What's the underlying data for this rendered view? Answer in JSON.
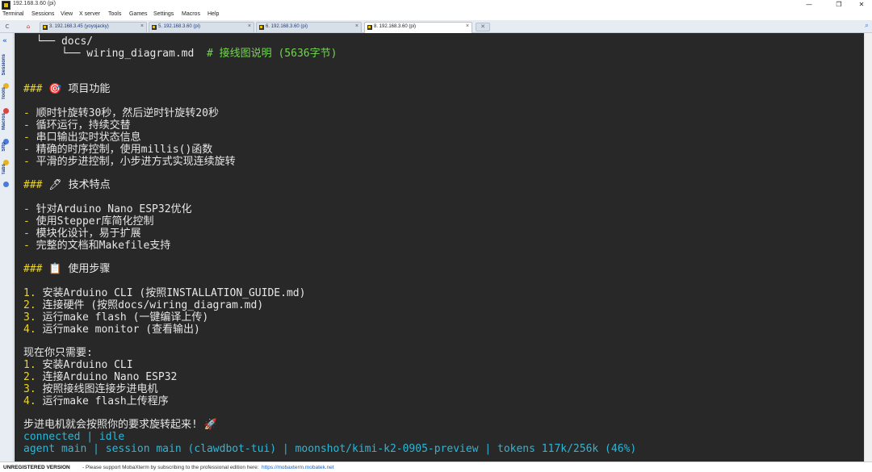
{
  "window": {
    "title": "192.168.3.60 (pi)",
    "minimize_glyph": "—",
    "restore_glyph": "❐",
    "close_glyph": "✕"
  },
  "menu": [
    "Terminal",
    "Sessions",
    "View",
    "X server",
    "Tools",
    "Games",
    "Settings",
    "Macros",
    "Help"
  ],
  "tabs": [
    {
      "label": "3. 192.168.3.45 (yoyojacky)",
      "active": false
    },
    {
      "label": "5. 192.168.3.60 (pi)",
      "active": false
    },
    {
      "label": "6. 192.168.3.60 (pi)",
      "active": false
    },
    {
      "label": "8. 192.168.3.60 (pi)",
      "active": true
    }
  ],
  "tab_close_glyph": "×",
  "sidebar": {
    "tabs": [
      "Sessions",
      "Tools",
      "Macros",
      "Sftp",
      "Tabs"
    ]
  },
  "terminal": {
    "tree_line_1": "  └── docs/",
    "tree_line_2_prefix": "      └── wiring_diagram.md  ",
    "tree_line_2_comment": "# 接线图说明 (5636字节)",
    "h_features_marker": "###",
    "h_features_text": " 🎯 项目功能",
    "features": [
      "顺时针旋转30秒，然后逆时针旋转20秒",
      "循环运行，持续交替",
      "串口输出实时状态信息",
      "精确的时序控制，使用millis()函数",
      "平滑的步进控制，小步进方式实现连续旋转"
    ],
    "h_tech_marker": "###",
    "h_tech_text": " 🖊 技术特点",
    "tech": [
      "针对Arduino Nano ESP32优化",
      "使用Stepper库简化控制",
      "模块化设计，易于扩展",
      "完整的文档和Makefile支持"
    ],
    "h_steps_marker": "###",
    "h_steps_text": " 📋 使用步骤",
    "steps": [
      "安装Arduino CLI (按照INSTALLATION_GUIDE.md)",
      "连接硬件 (按照docs/wiring_diagram.md)",
      "运行make flash (一键编译上传)",
      "运行make monitor (查看输出)"
    ],
    "now_heading": "现在你只需要:",
    "now_steps": [
      "安装Arduino CLI",
      "连接Arduino Nano ESP32",
      "按照接线图连接步进电机",
      "运行make flash上传程序"
    ],
    "closing": "步进电机就会按照你的要求旋转起来! 🚀",
    "status_line_1": "connected | idle",
    "status_line_2": "agent main | session main (clawdbot-tui) | moonshot/kimi-k2-0905-preview | tokens 117k/256k (46%)"
  },
  "statusbar": {
    "bold": "UNREGISTERED VERSION",
    "text": " -  Please support MobaXterm by subscribing to the professional edition here:",
    "link": "https://mobaxterm.mobatek.net"
  },
  "colors": {
    "terminal_bg": "#282828",
    "yellow": "#e9d42c",
    "green": "#6fd84b",
    "cyan": "#2db6d6",
    "accent_blue": "#1d3f8a"
  },
  "icons": [
    "app-icon",
    "session-icon",
    "settings-icon",
    "tools-icon",
    "macros-icon",
    "sftp-icon",
    "tabs-icon",
    "new-tab-icon",
    "paperclip-icon"
  ]
}
